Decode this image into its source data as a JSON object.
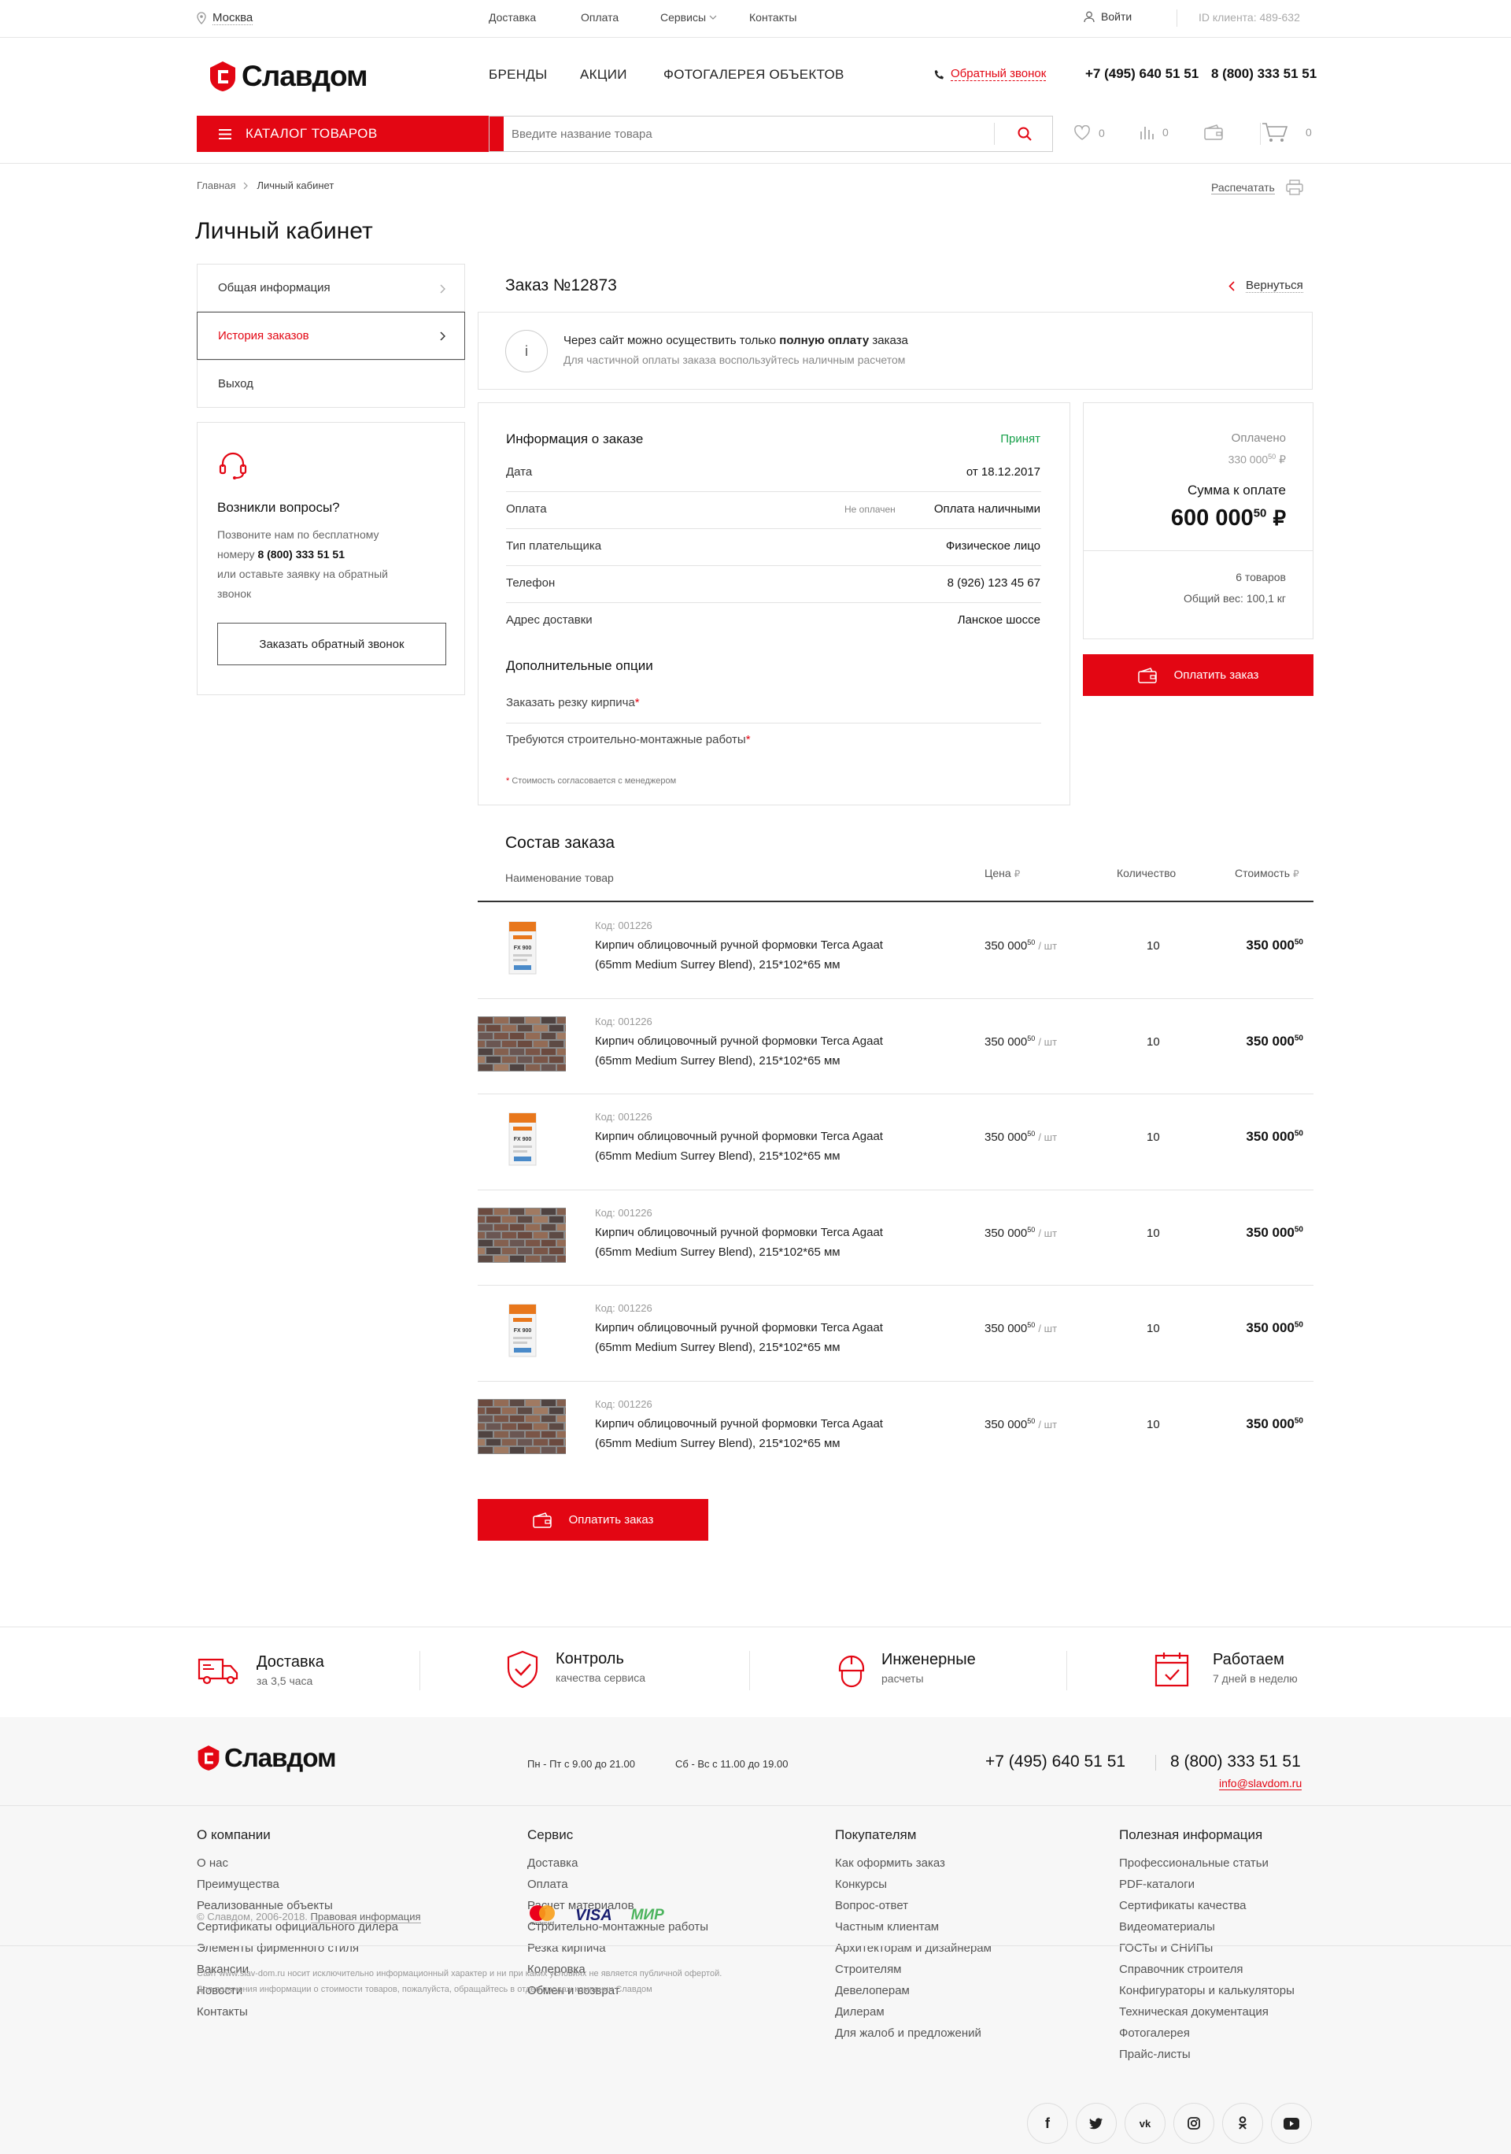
{
  "topbar": {
    "city": "Москва",
    "nav": [
      "Доставка",
      "Оплата",
      "Сервисы",
      "Контакты"
    ],
    "login": "Войти",
    "client_id": "ID клиента: 489-632"
  },
  "header": {
    "logo": "Славдом",
    "menu": [
      "БРЕНДЫ",
      "АКЦИИ",
      "ФОТОГАЛЕРЕЯ ОБЪЕКТОВ"
    ],
    "callback": "Обратный звонок",
    "phone1": "+7 (495) 640 51 51",
    "phone2": "8 (800) 333 51 51",
    "catalog": "КАТАЛОГ ТОВАРОВ",
    "search_placeholder": "Введите название товара",
    "favorites_count": "0",
    "compare_count": "0",
    "cart_count": "0",
    "brand_color": "#e30613"
  },
  "breadcrumb": [
    "Главная",
    "Личный кабинет"
  ],
  "print": "Распечатать",
  "page_title": "Личный кабинет",
  "sidebar": {
    "items": [
      "Общая информация",
      "История заказов",
      "Выход"
    ],
    "help": {
      "title": "Возникли вопросы?",
      "line1": "Позвоните нам по бесплатному",
      "line2_pre": "номеру",
      "phone": "8 (800) 333 51 51",
      "line3": "или оставьте заявку на обратный",
      "line4": "звонок",
      "button": "Заказать обратный звонок"
    }
  },
  "order": {
    "title": "Заказ №12873",
    "back": "Вернуться",
    "notice_pre": "Через сайт можно осуществить только ",
    "notice_bold": "полную оплату",
    "notice_post": " заказа",
    "notice_sub": "Для частичной оплаты заказа воспользуйтесь наличным расчетом",
    "info_title": "Информация о заказе",
    "status": "Принят",
    "rows": [
      {
        "label": "Дата",
        "value": "от 18.12.2017",
        "note": ""
      },
      {
        "label": "Оплата",
        "value": "Оплата наличными",
        "note": "Не оплачен"
      },
      {
        "label": "Тип плательщика",
        "value": "Физическое лицо",
        "note": ""
      },
      {
        "label": "Телефон",
        "value": "8 (926) 123 45 67",
        "note": ""
      },
      {
        "label": "Адрес доставки",
        "value": "Ланское шоссе",
        "note": ""
      }
    ],
    "options_title": "Дополнительные опции",
    "options": [
      "Заказать резку кирпича",
      "Требуются строительно-монтажные работы"
    ],
    "footnote": "Стоимость согласовается с менеджером",
    "summary": {
      "paid_label": "Оплачено",
      "paid_value": "330 000",
      "paid_cents": "50",
      "due_label": "Сумма к оплате",
      "due_value": "600 000",
      "due_cents": "50",
      "currency": "₽",
      "items": "6 товаров",
      "weight": "Общий вес: 100,1 кг"
    },
    "pay_button": "Оплатить заказ"
  },
  "composition": {
    "title": "Состав заказа",
    "headers": {
      "name": "Наименование товар",
      "price": "Цена",
      "qty": "Количество",
      "cost": "Стоимость",
      "currency": "₽"
    },
    "items": [
      {
        "code": "Код: 001226",
        "name1": "Кирпич облицовочный ручной формовки Terca Agaat",
        "name2": "(65mm Medium Surrey Blend), 215*102*65 мм",
        "price": "350 000",
        "cents": "50",
        "unit": "/ шт",
        "qty": "10",
        "cost": "350 000",
        "cost_cents": "50",
        "image": "bag"
      },
      {
        "code": "Код: 001226",
        "name1": "Кирпич облицовочный ручной формовки Terca Agaat",
        "name2": "(65mm Medium Surrey Blend), 215*102*65 мм",
        "price": "350 000",
        "cents": "50",
        "unit": "/ шт",
        "qty": "10",
        "cost": "350 000",
        "cost_cents": "50",
        "image": "brick"
      },
      {
        "code": "Код: 001226",
        "name1": "Кирпич облицовочный ручной формовки Terca Agaat",
        "name2": "(65mm Medium Surrey Blend), 215*102*65 мм",
        "price": "350 000",
        "cents": "50",
        "unit": "/ шт",
        "qty": "10",
        "cost": "350 000",
        "cost_cents": "50",
        "image": "bag"
      },
      {
        "code": "Код: 001226",
        "name1": "Кирпич облицовочный ручной формовки Terca Agaat",
        "name2": "(65mm Medium Surrey Blend), 215*102*65 мм",
        "price": "350 000",
        "cents": "50",
        "unit": "/ шт",
        "qty": "10",
        "cost": "350 000",
        "cost_cents": "50",
        "image": "brick"
      },
      {
        "code": "Код: 001226",
        "name1": "Кирпич облицовочный ручной формовки Terca Agaat",
        "name2": "(65mm Medium Surrey Blend), 215*102*65 мм",
        "price": "350 000",
        "cents": "50",
        "unit": "/ шт",
        "qty": "10",
        "cost": "350 000",
        "cost_cents": "50",
        "image": "bag"
      },
      {
        "code": "Код: 001226",
        "name1": "Кирпич облицовочный ручной формовки Terca Agaat",
        "name2": "(65mm Medium Surrey Blend), 215*102*65 мм",
        "price": "350 000",
        "cents": "50",
        "unit": "/ шт",
        "qty": "10",
        "cost": "350 000",
        "cost_cents": "50",
        "image": "brick"
      }
    ],
    "bag_label": "FX 900",
    "pay_button": "Оплатить заказ"
  },
  "features": [
    {
      "title": "Доставка",
      "sub": "за 3,5 часа",
      "icon": "truck-icon"
    },
    {
      "title": "Контроль",
      "sub": "качества сервиса",
      "icon": "shield-check-icon"
    },
    {
      "title": "Инженерные",
      "sub": "расчеты",
      "icon": "helmet-icon"
    },
    {
      "title": "Работаем",
      "sub": "7 дней в неделю",
      "icon": "calendar-icon"
    }
  ],
  "footer": {
    "logo": "Славдом",
    "hours1": "Пн - Пт с 9.00 до 21.00",
    "hours2": "Сб - Вс с 11.00 до 19.00",
    "phone1": "+7 (495) 640 51 51",
    "phone2": "8 (800) 333 51 51",
    "email": "info@slavdom.ru",
    "columns": [
      {
        "title": "О компании",
        "links": [
          "О нас",
          "Преимущества",
          "Реализованные объекты",
          "Сертификаты официального дилера",
          "Элементы фирменного стиля",
          "Вакансии",
          "Новости",
          "Контакты"
        ]
      },
      {
        "title": "Сервис",
        "links": [
          "Доставка",
          "Оплата",
          "Расчет материалов",
          "Строительно-монтажные работы",
          "Резка кирпича",
          "Колеровка",
          "Обмен и возврат"
        ]
      },
      {
        "title": "Покупателям",
        "links": [
          "Как оформить заказ",
          "Конкурсы",
          "Вопрос-ответ",
          "Частным клиентам",
          "Архитекторам и дизайнерам",
          "Строителям",
          "Девелоперам",
          "Дилерам",
          "Для жалоб и предложений"
        ]
      },
      {
        "title": "Полезная информация",
        "links": [
          "Профессиональные статьи",
          "PDF-каталоги",
          "Сертификаты качества",
          "Видеоматериалы",
          "ГОСТы и СНИПы",
          "Справочник строителя",
          "Конфигураторы и калькуляторы",
          "Техническая документация",
          "Фотогалерея",
          "Прайс-листы"
        ]
      }
    ],
    "copyright": "© Славдом, 2006-2018.",
    "legal": "Правовая информация",
    "payments": [
      "mastercard",
      "VISA",
      "МИР"
    ],
    "disclaimer1": "Сайт www.slav-dom.ru носит исключительно информационный характер и ни при каких условиях не является публичной офертой.",
    "disclaimer2": "Для получения информации о стоимости товаров, пожалуйста, обращайтесь в отдел продаж компании Славдом",
    "social": [
      "f",
      "t",
      "vk",
      "ig",
      "ok",
      "yt"
    ]
  }
}
